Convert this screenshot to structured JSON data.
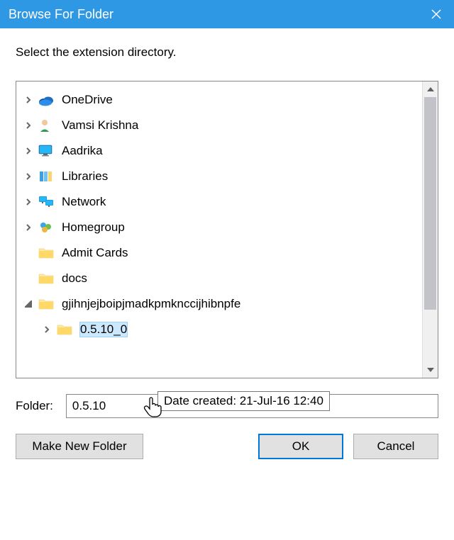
{
  "window": {
    "title": "Browse For Folder"
  },
  "instruction": "Select the extension directory.",
  "tree_items": [
    {
      "label": "OneDrive",
      "icon": "onedrive",
      "expander": "closed",
      "indent": 0,
      "selected": false
    },
    {
      "label": "Vamsi Krishna",
      "icon": "user",
      "expander": "closed",
      "indent": 0,
      "selected": false
    },
    {
      "label": "Aadrika",
      "icon": "monitor",
      "expander": "closed",
      "indent": 0,
      "selected": false
    },
    {
      "label": "Libraries",
      "icon": "libraries",
      "expander": "closed",
      "indent": 0,
      "selected": false
    },
    {
      "label": "Network",
      "icon": "network",
      "expander": "closed",
      "indent": 0,
      "selected": false
    },
    {
      "label": "Homegroup",
      "icon": "homegroup",
      "expander": "closed",
      "indent": 0,
      "selected": false
    },
    {
      "label": "Admit Cards",
      "icon": "folder",
      "expander": "none",
      "indent": 0,
      "selected": false
    },
    {
      "label": "docs",
      "icon": "folder",
      "expander": "none",
      "indent": 0,
      "selected": false
    },
    {
      "label": "gjihnjejboipjmadkpmknccijhibnpfe",
      "icon": "folder",
      "expander": "open",
      "indent": 0,
      "selected": false
    },
    {
      "label": "0.5.10_0",
      "icon": "folder",
      "expander": "closed",
      "indent": 1,
      "selected": true
    }
  ],
  "folder_field": {
    "label": "Folder:",
    "value": "0.5.10"
  },
  "tooltip": "Date created: 21-Jul-16 12:40",
  "buttons": {
    "make_new": "Make New Folder",
    "ok": "OK",
    "cancel": "Cancel"
  }
}
